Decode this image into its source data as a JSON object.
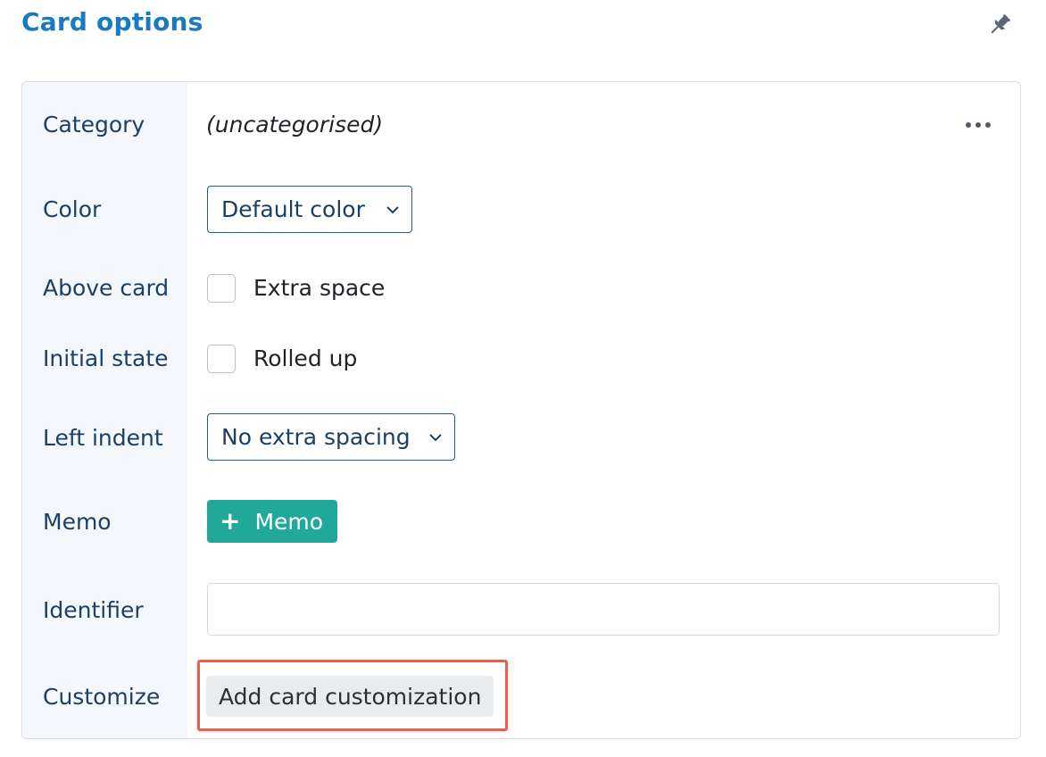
{
  "header": {
    "title": "Card options",
    "pin_icon": "pin-icon"
  },
  "colors": {
    "title": "#1a7abf",
    "label": "#1c3f66",
    "memo_button": "#21a89a",
    "highlight": "#e5614f",
    "label_column_bg": "#f4f8fc"
  },
  "fields": {
    "category": {
      "label": "Category",
      "value": "(uncategorised)",
      "more_icon": "more-horizontal-icon"
    },
    "color": {
      "label": "Color",
      "selected": "Default color"
    },
    "above_card": {
      "label": "Above card",
      "checkbox_label": "Extra space",
      "checked": false
    },
    "initial_state": {
      "label": "Initial state",
      "checkbox_label": "Rolled up",
      "checked": false
    },
    "left_indent": {
      "label": "Left indent",
      "selected": "No extra spacing"
    },
    "memo": {
      "label": "Memo",
      "button_icon": "+",
      "button_label": "Memo"
    },
    "identifier": {
      "label": "Identifier",
      "value": ""
    },
    "customize": {
      "label": "Customize",
      "button_label": "Add card customization"
    }
  }
}
